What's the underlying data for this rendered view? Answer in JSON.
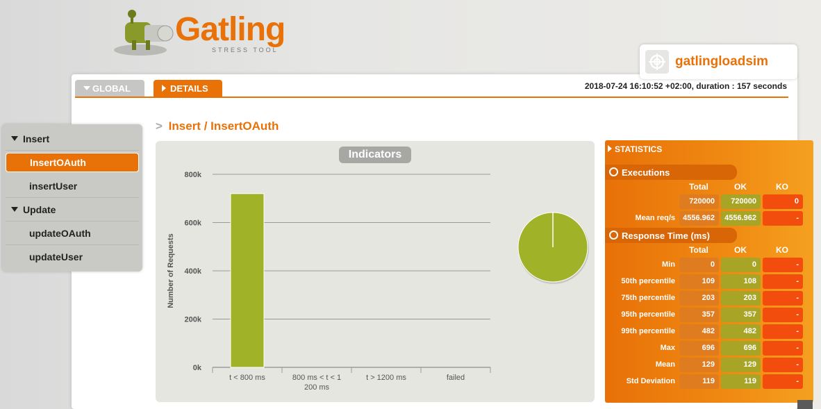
{
  "app": {
    "logo_text": "Gatling",
    "logo_sub": "STRESS TOOL",
    "simulation_name": "gatlingloadsim"
  },
  "tabs": [
    {
      "label": "GLOBAL"
    },
    {
      "label": "DETAILS"
    }
  ],
  "run_info": "2018-07-24 16:10:52 +02:00, duration : 157 seconds",
  "sidebar": {
    "groups": [
      {
        "label": "Insert",
        "items": [
          {
            "label": "InsertOAuth"
          },
          {
            "label": "insertUser"
          }
        ]
      },
      {
        "label": "Update",
        "items": [
          {
            "label": "updateOAuth"
          },
          {
            "label": "updateUser"
          }
        ]
      }
    ]
  },
  "breadcrumb": {
    "sep": ">",
    "text": "Insert / InsertOAuth"
  },
  "indicators": {
    "title": "Indicators"
  },
  "chart_data": [
    {
      "type": "bar",
      "title": "",
      "xlabel": "",
      "ylabel": "Number of Requests",
      "categories": [
        "t < 800 ms",
        "800 ms < t < 1200 ms",
        "t > 1200 ms",
        "failed"
      ],
      "values": [
        720000,
        0,
        0,
        0
      ],
      "ylim": [
        0,
        800000
      ],
      "yticks": [
        "0k",
        "200k",
        "400k",
        "600k",
        "800k"
      ],
      "ytick_values": [
        0,
        200000,
        400000,
        600000,
        800000
      ],
      "grid": true,
      "color": "#a0b228"
    },
    {
      "type": "pie",
      "values": [
        720000,
        0,
        0,
        0
      ],
      "colors": [
        "#a0b228",
        "#f5a020",
        "#e87108",
        "#f24d0c"
      ]
    }
  ],
  "statistics": {
    "title": "STATISTICS",
    "executions": {
      "title": "Executions",
      "headers": [
        "Total",
        "OK",
        "KO"
      ],
      "rows": [
        {
          "label": "",
          "total": "720000",
          "ok": "720000",
          "ko": "0"
        },
        {
          "label": "Mean req/s",
          "total": "4556.962",
          "ok": "4556.962",
          "ko": "-"
        }
      ]
    },
    "response_time": {
      "title": "Response Time (ms)",
      "headers": [
        "Total",
        "OK",
        "KO"
      ],
      "rows": [
        {
          "label": "Min",
          "total": "0",
          "ok": "0",
          "ko": "-"
        },
        {
          "label": "50th percentile",
          "total": "109",
          "ok": "108",
          "ko": "-"
        },
        {
          "label": "75th percentile",
          "total": "203",
          "ok": "203",
          "ko": "-"
        },
        {
          "label": "95th percentile",
          "total": "357",
          "ok": "357",
          "ko": "-"
        },
        {
          "label": "99th percentile",
          "total": "482",
          "ok": "482",
          "ko": "-"
        },
        {
          "label": "Max",
          "total": "696",
          "ok": "696",
          "ko": "-"
        },
        {
          "label": "Mean",
          "total": "129",
          "ok": "129",
          "ko": "-"
        },
        {
          "label": "Std Deviation",
          "total": "119",
          "ok": "119",
          "ko": "-"
        }
      ]
    }
  }
}
